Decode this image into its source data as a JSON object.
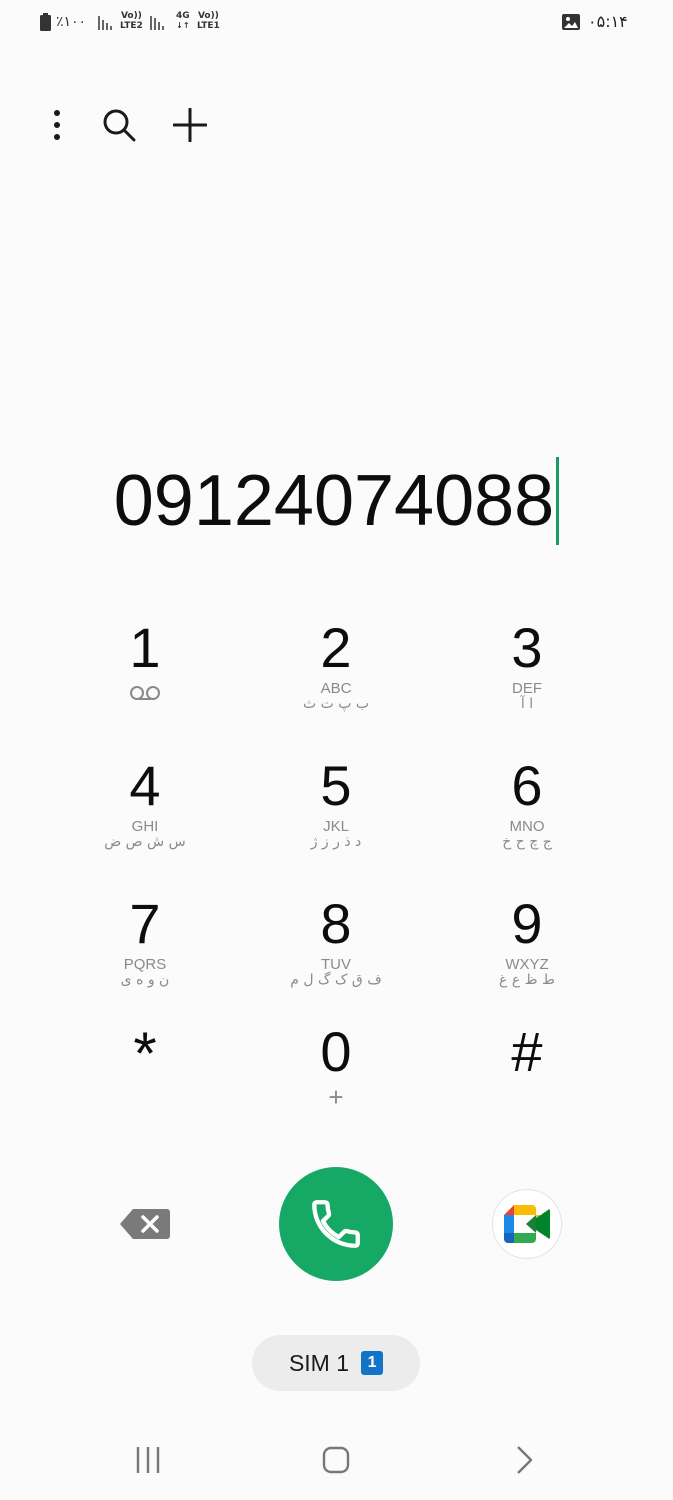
{
  "status_bar": {
    "battery_text": "٪۱۰۰",
    "sim2_label_top": "Vo))",
    "sim2_label_bottom": "LTE2",
    "sim1_label_4g": "4G",
    "sim1_label_top": "Vo))",
    "sim1_label_bottom": "LTE1",
    "time": "۰۵:۱۴",
    "icons": [
      "battery-icon",
      "signal-icon",
      "gallery-icon"
    ]
  },
  "toolbar": {
    "icons": [
      "more-options-icon",
      "search-icon",
      "add-icon"
    ]
  },
  "dialer": {
    "number": "09124074088",
    "cursor_color": "#1c9a66"
  },
  "keypad": {
    "keys": [
      {
        "digit": "1",
        "letters": "",
        "persian": "",
        "icon": "voicemail-icon"
      },
      {
        "digit": "2",
        "letters": "ABC",
        "persian": "ب پ ت ث"
      },
      {
        "digit": "3",
        "letters": "DEF",
        "persian": "ا آ"
      },
      {
        "digit": "4",
        "letters": "GHI",
        "persian": "س ش ص ض"
      },
      {
        "digit": "5",
        "letters": "JKL",
        "persian": "د ذ ر ز ژ"
      },
      {
        "digit": "6",
        "letters": "MNO",
        "persian": "ج چ ح خ"
      },
      {
        "digit": "7",
        "letters": "PQRS",
        "persian": "ن و ه ی"
      },
      {
        "digit": "8",
        "letters": "TUV",
        "persian": "ف ق ک گ ل م"
      },
      {
        "digit": "9",
        "letters": "WXYZ",
        "persian": "ط ظ ع غ"
      },
      {
        "digit": "*",
        "letters": "",
        "persian": ""
      },
      {
        "digit": "0",
        "letters": "",
        "persian": "",
        "sub": "+"
      },
      {
        "digit": "#",
        "letters": "",
        "persian": ""
      }
    ]
  },
  "actions": {
    "call_color": "#16a865",
    "icons": [
      "backspace-icon",
      "phone-icon",
      "google-meet-icon"
    ]
  },
  "sim": {
    "label": "SIM 1",
    "badge": "1",
    "badge_color": "#1273c7"
  },
  "nav": {
    "icons": [
      "recent-apps-icon",
      "home-icon",
      "back-icon"
    ]
  }
}
